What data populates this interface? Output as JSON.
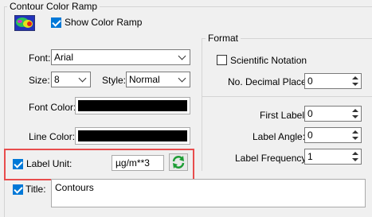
{
  "colors": {
    "accent": "#0078d7",
    "highlight": "#e84d4d",
    "refresh_green": "#1e9d35"
  },
  "contour_color_ramp": {
    "title": "Contour Color Ramp",
    "ramp_icon": "color-ramp-icon",
    "show_color_ramp_label": "Show Color Ramp",
    "show_color_ramp_checked": true
  },
  "font": {
    "font_label": "Font:",
    "font_value": "Arial",
    "size_label": "Size:",
    "size_value": "8",
    "style_label": "Style:",
    "style_value": "Normal",
    "font_color_label": "Font Color:",
    "line_color_label": "Line Color:"
  },
  "label_unit": {
    "label": "Label Unit:",
    "checked": true,
    "value": "µg/m**3",
    "refresh_icon": "refresh-icon"
  },
  "title_row": {
    "label": "Title:",
    "checked": true,
    "value": "Contours"
  },
  "format": {
    "title": "Format",
    "scientific_notation_label": "Scientific Notation",
    "scientific_notation_checked": false,
    "decimal_places_label": "No. Decimal Places:",
    "decimal_places_value": "0",
    "first_label_label": "First Label:",
    "first_label_value": "0",
    "label_angle_label": "Label Angle:",
    "label_angle_value": "0",
    "label_frequency_label": "Label Frequency:",
    "label_frequency_value": "1"
  }
}
